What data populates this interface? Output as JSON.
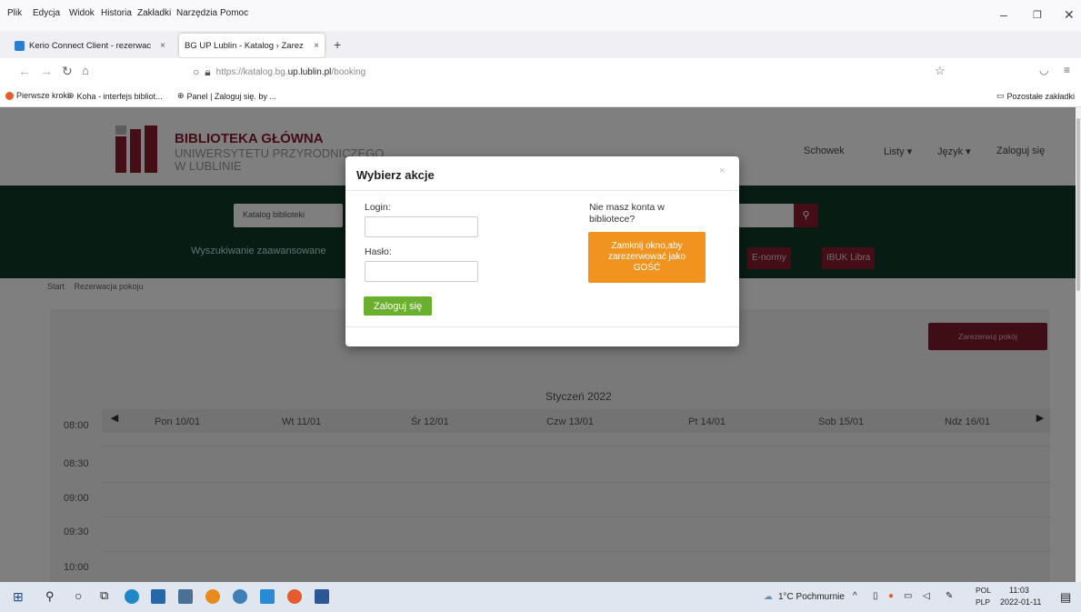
{
  "browser": {
    "menu": [
      "Plik",
      "Edycja",
      "Widok",
      "Historia",
      "Zakładki",
      "Narzędzia",
      "Pomoc"
    ],
    "tabs": [
      {
        "label": "Kerio Connect Client - rezerwac",
        "close": "×"
      },
      {
        "label": "BG UP Lublin - Katalog › Zarez",
        "close": "×"
      }
    ],
    "new_tab": "+",
    "url_prefix": "https://katalog.bg.",
    "url_domain": "up.lublin.pl",
    "url_path": "/booking",
    "bookmarks": [
      "Pierwsze kroki",
      "Koha - interfejs bibliot...",
      "Panel | Zaloguj się. by ..."
    ],
    "other_bookmarks": "Pozostałe zakładki"
  },
  "site": {
    "logo_line1": "BIBLIOTEKA GŁÓWNA",
    "logo_line2": "UNIWERSYTETU PRZYRODNICZEGO",
    "logo_line3": "W LUBLINIE",
    "nav": [
      "Schowek",
      "Listy ▾",
      "Język ▾",
      "Zaloguj się"
    ],
    "catalog_select": "Katalog biblioteki",
    "advanced_search": "Wyszukiwanie zaawansowane",
    "quick_links": [
      "E-normy",
      "IBUK Libra"
    ],
    "breadcrumbs": [
      "Start",
      "Rezerwacja pokoju"
    ],
    "reserve_button": "Zarezerwuj pokój",
    "month": "Styczeń 2022",
    "days": [
      "Pon 10/01",
      "Wt 11/01",
      "Śr 12/01",
      "Czw 13/01",
      "Pt 14/01",
      "Sob 15/01",
      "Ndz 16/01"
    ],
    "times": [
      "08:00",
      "08:30",
      "09:00",
      "09:30",
      "10:00"
    ]
  },
  "modal": {
    "title": "Wybierz akcje",
    "close": "×",
    "login_label": "Login:",
    "password_label": "Hasło:",
    "login_button": "Zaloguj się",
    "no_account_text": "Nie masz konta w bibliotece?",
    "guest_button": "Zamknij okno,aby zarezerwować jako GOŚĆ"
  },
  "taskbar": {
    "weather": "1°C Pochmurnie",
    "lang1": "POL",
    "lang2": "PLP",
    "time": "11:03",
    "date": "2022-01-11"
  },
  "colors": {
    "header_green": "#0e3b26",
    "logo_red": "#8b1a2b",
    "login_green": "#6aaf2d",
    "guest_orange": "#f0941f",
    "reserve_red": "#7d1a2a"
  }
}
